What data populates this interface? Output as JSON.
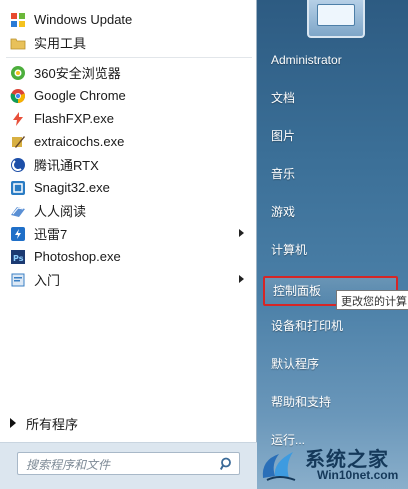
{
  "programs": [
    {
      "label": "Windows Update",
      "icon": "windows-update-icon",
      "color": "#2b6cb4"
    },
    {
      "label": "实用工具",
      "icon": "folder-icon",
      "color": "#e2b84a"
    },
    {
      "label": "360安全浏览器",
      "icon": "360-browser-icon",
      "color": "#47a23c"
    },
    {
      "label": "Google Chrome",
      "icon": "chrome-icon",
      "color": "#d9463b"
    },
    {
      "label": "FlashFXP.exe",
      "icon": "flashfxp-icon",
      "color": "#d04a3a"
    },
    {
      "label": "extraicochs.exe",
      "icon": "extraicochs-icon",
      "color": "#c8a33a"
    },
    {
      "label": "腾讯通RTX",
      "icon": "rtx-icon",
      "color": "#2459b5"
    },
    {
      "label": "Snagit32.exe",
      "icon": "snagit-icon",
      "color": "#2a7cc4"
    },
    {
      "label": "人人阅读",
      "icon": "reader-icon",
      "color": "#4a7fc4"
    },
    {
      "label": "迅雷7",
      "icon": "thunder-icon",
      "color": "#1f6fc8"
    },
    {
      "label": "Photoshop.exe",
      "icon": "photoshop-icon",
      "color": "#21407c"
    },
    {
      "label": "入门",
      "icon": "getting-started-icon",
      "color": "#3a7fc4"
    }
  ],
  "all_programs_label": "所有程序",
  "search": {
    "placeholder": "搜索程序和文件"
  },
  "right_links": [
    {
      "label": "Administrator"
    },
    {
      "label": "文档"
    },
    {
      "label": "图片"
    },
    {
      "label": "音乐"
    },
    {
      "label": "游戏"
    },
    {
      "label": "计算机"
    },
    {
      "label": "控制面板"
    },
    {
      "label": "设备和打印机"
    },
    {
      "label": "默认程序"
    },
    {
      "label": "帮助和支持"
    },
    {
      "label": "运行..."
    }
  ],
  "tooltip": "更改您的计算",
  "logo": {
    "title": "系统之家",
    "sub": "Win10net.com"
  }
}
